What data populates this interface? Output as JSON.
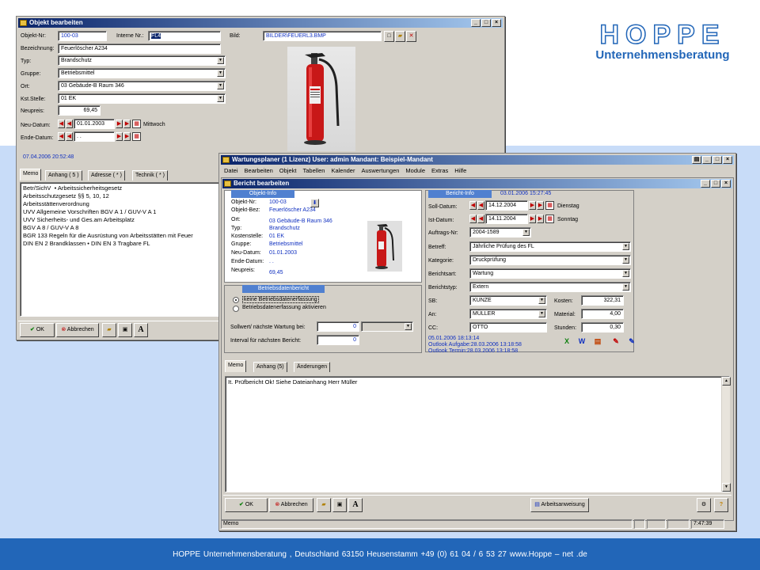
{
  "logo": {
    "title": "HOPPE",
    "subtitle": "Unternehmensberatung"
  },
  "footer": {
    "text": "HOPPE Unternehmensberatung , Deutschland 63150 Heusenstamm     +49 (0) 61 04 / 6 53 27  www.Hoppe – net .de"
  },
  "win1": {
    "title": "Objekt bearbeiten",
    "labels": {
      "objektnr": "Objekt-Nr:",
      "internenr": "Interne Nr.:",
      "bild": "Bild:",
      "bezeichnung": "Bezeichnung:",
      "typ": "Typ:",
      "gruppe": "Gruppe:",
      "ort": "Ort:",
      "kst": "Kst.Stelle:",
      "neupreis": "Neupreis:",
      "neudatum": "Neu-Datum:",
      "endedatum": "Ende-Datum:"
    },
    "values": {
      "objektnr": "100-03",
      "internenr": "FL4",
      "bild": "BILDER\\FEUERL3.BMP",
      "bezeichnung": "Feuerlöscher A234",
      "typ": "Brandschutz",
      "gruppe": "Betriebsmittel",
      "ort": "03 Gebäude-B Raum 346",
      "kst": "01 EK",
      "neupreis": "69,45",
      "neudatum": "01.01.2003",
      "wochentag": "Mittwoch",
      "endedatum": ". ."
    },
    "timestamp": "07.04.2006 20:52:48",
    "tabs": [
      "Memo",
      "Anhang ( 5 )",
      "Adresse ( * )",
      "Technik ( * )"
    ],
    "memo": "Betr/SichV  • Arbeitssicherheitsgesetz\nArbeitsschutzgesetz §§ 5, 10, 12\nArbeitsstättenverordnung\nUVV Allgemeine Vorschriften BGV A 1 / GUV-V A 1\nUVV Sicherheits- und Ges.am Arbeitsplatz\nBGV A 8 / GUV-V A 8\nBGR 133 Regeln für die Ausrüstung von Arbeitsstätten mit Feuer\nDIN EN 2 Brandklassen • DIN EN 3 Tragbare FL",
    "buttons": {
      "ok": "OK",
      "abbrechen": "Abbrechen"
    }
  },
  "win2": {
    "title": "Wartungsplaner  (1 Lizenz)   User: admin   Mandant: Beispiel-Mandant",
    "menu": [
      "Datei",
      "Bearbeiten",
      "Objekt",
      "Tabellen",
      "Kalender",
      "Auswertungen",
      "Module",
      "Extras",
      "Hilfe"
    ],
    "inner_title": "Bericht bearbeiten",
    "objekt_info": {
      "header": "Objekt-Info",
      "labels": [
        "Objekt-Nr:",
        "Objekt-Bez:",
        "Ort:",
        "Typ:",
        "Kostenstelle:",
        "Gruppe:",
        "Neu-Datum:",
        "Ende-Datum:",
        "Neupreis:"
      ],
      "values": [
        "100-03",
        "Feuerlöscher A234",
        "03 Gebäude-B Raum 346",
        "Brandschutz",
        "01 EK",
        "Betriebsmittel",
        "01.01.2003",
        ". .",
        "69,45"
      ]
    },
    "bericht_info": {
      "header": "Bericht-Info",
      "datetime": "03.01.2006 15:27:45"
    },
    "betriebsdaten": {
      "header": "Betriebsdatenbericht",
      "radio1": "keine Betriebsdatenerfassung",
      "radio2": "Betriebsdatenerfassung aktivieren",
      "soll_label": "Sollwert/ nächste Wartung bei:",
      "soll_value": "0",
      "intervall_label": "Interval für nächsten Bericht:",
      "intervall_value": "0"
    },
    "fields": {
      "soll_label": "Soll-Datum:",
      "soll": "14.12.2004",
      "soll_tag": "Dienstag",
      "ist_label": "Ist-Datum:",
      "ist": "14.11.2004",
      "ist_tag": "Sonntag",
      "auftrag_label": "Auftrags-Nr:",
      "auftrag": "2004-1589",
      "betreff_label": "Betreff:",
      "betreff": "Jährliche Prüfung des FL",
      "kategorie_label": "Kategorie:",
      "kategorie": "Druckprüfung",
      "berichtsart_label": "Berichtsart:",
      "berichtsart": "Wartung",
      "berichtstyp_label": "Berichtstyp:",
      "berichtstyp": "Extern",
      "sb_label": "SB:",
      "sb": "KUNZE",
      "an_label": "An:",
      "an": "MÜLLER",
      "cc_label": "CC:",
      "cc": "OTTO",
      "kosten_label": "Kosten:",
      "kosten": "322,31",
      "material_label": "Material:",
      "material": "4,00",
      "stunden_label": "Stunden:",
      "stunden": "0,30"
    },
    "outlook": [
      "05.01.2006 18:13:14",
      "Outlook Aufgabe:28.03.2006 13:18:58",
      "Outlook Termin:28.03.2006 13:18:58"
    ],
    "tabs": [
      "Memo",
      "Anhang (5)",
      "Änderungen"
    ],
    "memo": "It. Prüfbericht Ok! Siehe Dateianhang Herr Müller",
    "buttons": {
      "ok": "OK",
      "abbrechen": "Abbrechen",
      "arbeitsanweisung": "Arbeitsanweisung"
    },
    "status": {
      "left": "Memo",
      "time": "7:47:39"
    }
  }
}
